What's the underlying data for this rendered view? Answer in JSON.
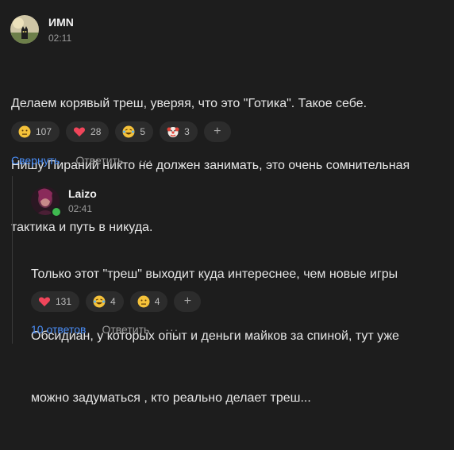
{
  "comments": [
    {
      "author": "ИМN",
      "time": "02:11",
      "text_lines": [
        "Делаем корявый треш, уверяя, что это \"Готика\". Такое себе.",
        "Нишу Пираний никто не должен занимать, это очень сомнительная",
        "тактика и путь в никуда."
      ],
      "reactions": [
        {
          "icon": "neutral-face-emoji",
          "count": "107"
        },
        {
          "icon": "heart-emoji",
          "count": "28"
        },
        {
          "icon": "laughing-tears-emoji",
          "count": "5"
        },
        {
          "icon": "clown-face-emoji",
          "count": "3"
        }
      ],
      "add_reaction_label": "+",
      "actions": {
        "primary": "Свернуть",
        "reply": "Ответить",
        "more": "···"
      }
    },
    {
      "author": "Laizo",
      "time": "02:41",
      "text_lines": [
        "Только этот \"треш\" выходит куда интереснее, чем новые игры",
        "Обсидиан, у которых опыт и деньги майков за спиной, тут уже",
        "можно задуматься , кто реально делает треш..."
      ],
      "reactions": [
        {
          "icon": "heart-emoji",
          "count": "131"
        },
        {
          "icon": "laughing-tears-emoji",
          "count": "4"
        },
        {
          "icon": "neutral-face-emoji",
          "count": "4"
        }
      ],
      "add_reaction_label": "+",
      "actions": {
        "primary": "10 ответов",
        "reply": "Ответить",
        "more": "···"
      }
    }
  ],
  "colors": {
    "background": "#1d1d1d",
    "link": "#4a8df5",
    "online": "#3fb950"
  }
}
